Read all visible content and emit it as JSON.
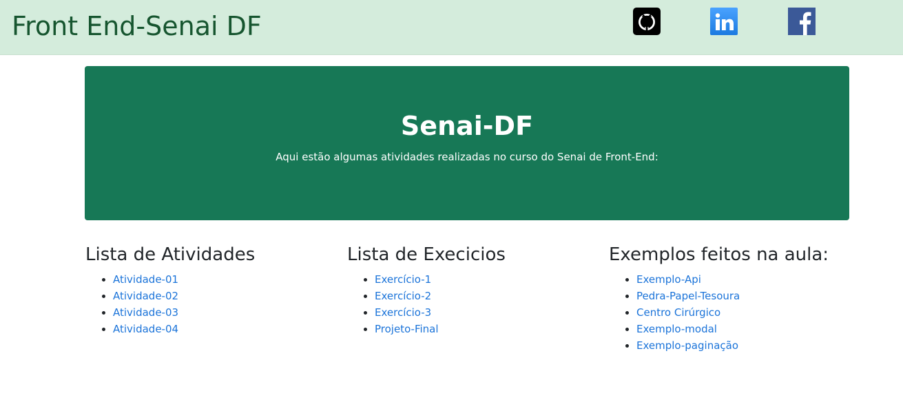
{
  "navbar": {
    "brand": "Front End-Senai DF",
    "social": [
      {
        "name": "github-icon",
        "color": "#000000"
      },
      {
        "name": "linkedin-icon",
        "color": "#2d8ef0"
      },
      {
        "name": "facebook-icon",
        "color": "#3b5998"
      }
    ]
  },
  "hero": {
    "title": "Senai-DF",
    "text": "Aqui estão algumas atividades realizadas no curso do Senai de Front-End:"
  },
  "sections": [
    {
      "title": "Lista de Atividades",
      "items": [
        "Atividade-01",
        "Atividade-02",
        "Atividade-03",
        "Atividade-04"
      ]
    },
    {
      "title": "Lista de Execicios",
      "items": [
        "Exercício-1",
        "Exercício-2",
        "Exercício-3",
        "Projeto-Final"
      ]
    },
    {
      "title": "Exemplos feitos na aula:",
      "items": [
        "Exemplo-Api",
        "Pedra-Papel-Tesoura",
        "Centro Cirúrgico",
        "Exemplo-modal",
        "Exemplo-paginação"
      ]
    }
  ],
  "colors": {
    "navbar_bg": "#d4ecdc",
    "brand": "#16552f",
    "hero_bg": "#177856",
    "link": "#1a73d9"
  }
}
